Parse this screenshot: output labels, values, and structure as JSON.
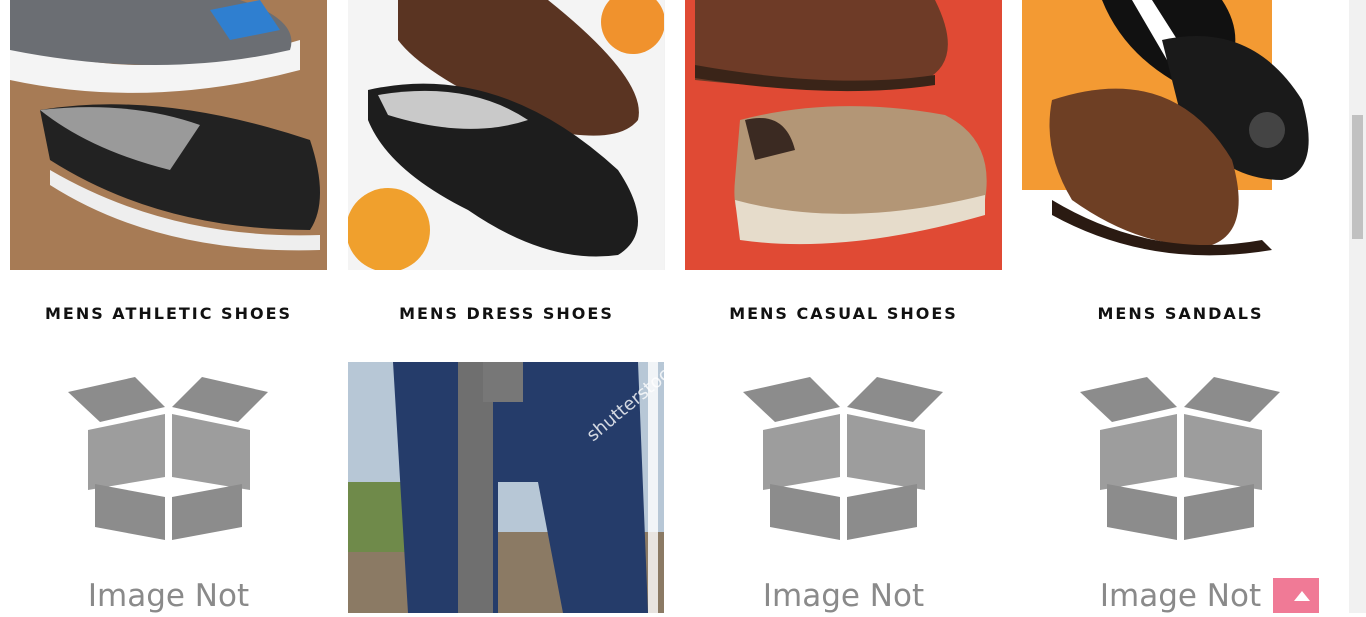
{
  "categories": [
    {
      "title": "MENS ATHLETIC SHOES",
      "image": "athletic-shoes-photo"
    },
    {
      "title": "MENS DRESS SHOES",
      "image": "dress-shoes-photo"
    },
    {
      "title": "MENS CASUAL SHOES",
      "image": "casual-shoes-photo"
    },
    {
      "title": "MENS SANDALS",
      "image": "sandals-photo"
    }
  ],
  "row2": [
    {
      "image": "image-not-available-placeholder",
      "text": "Image Not"
    },
    {
      "image": "jackhammer-worker-photo",
      "watermark": "shutterstock"
    },
    {
      "image": "image-not-available-placeholder",
      "text": "Image Not"
    },
    {
      "image": "image-not-available-placeholder",
      "text": "Image Not"
    }
  ],
  "icons": {
    "back_to_top": "arrow-up-icon",
    "placeholder": "open-box-icon"
  },
  "colors": {
    "title_text": "#111111",
    "back_to_top_bg": "#f07a96",
    "placeholder_gray": "#8a8a8a"
  }
}
